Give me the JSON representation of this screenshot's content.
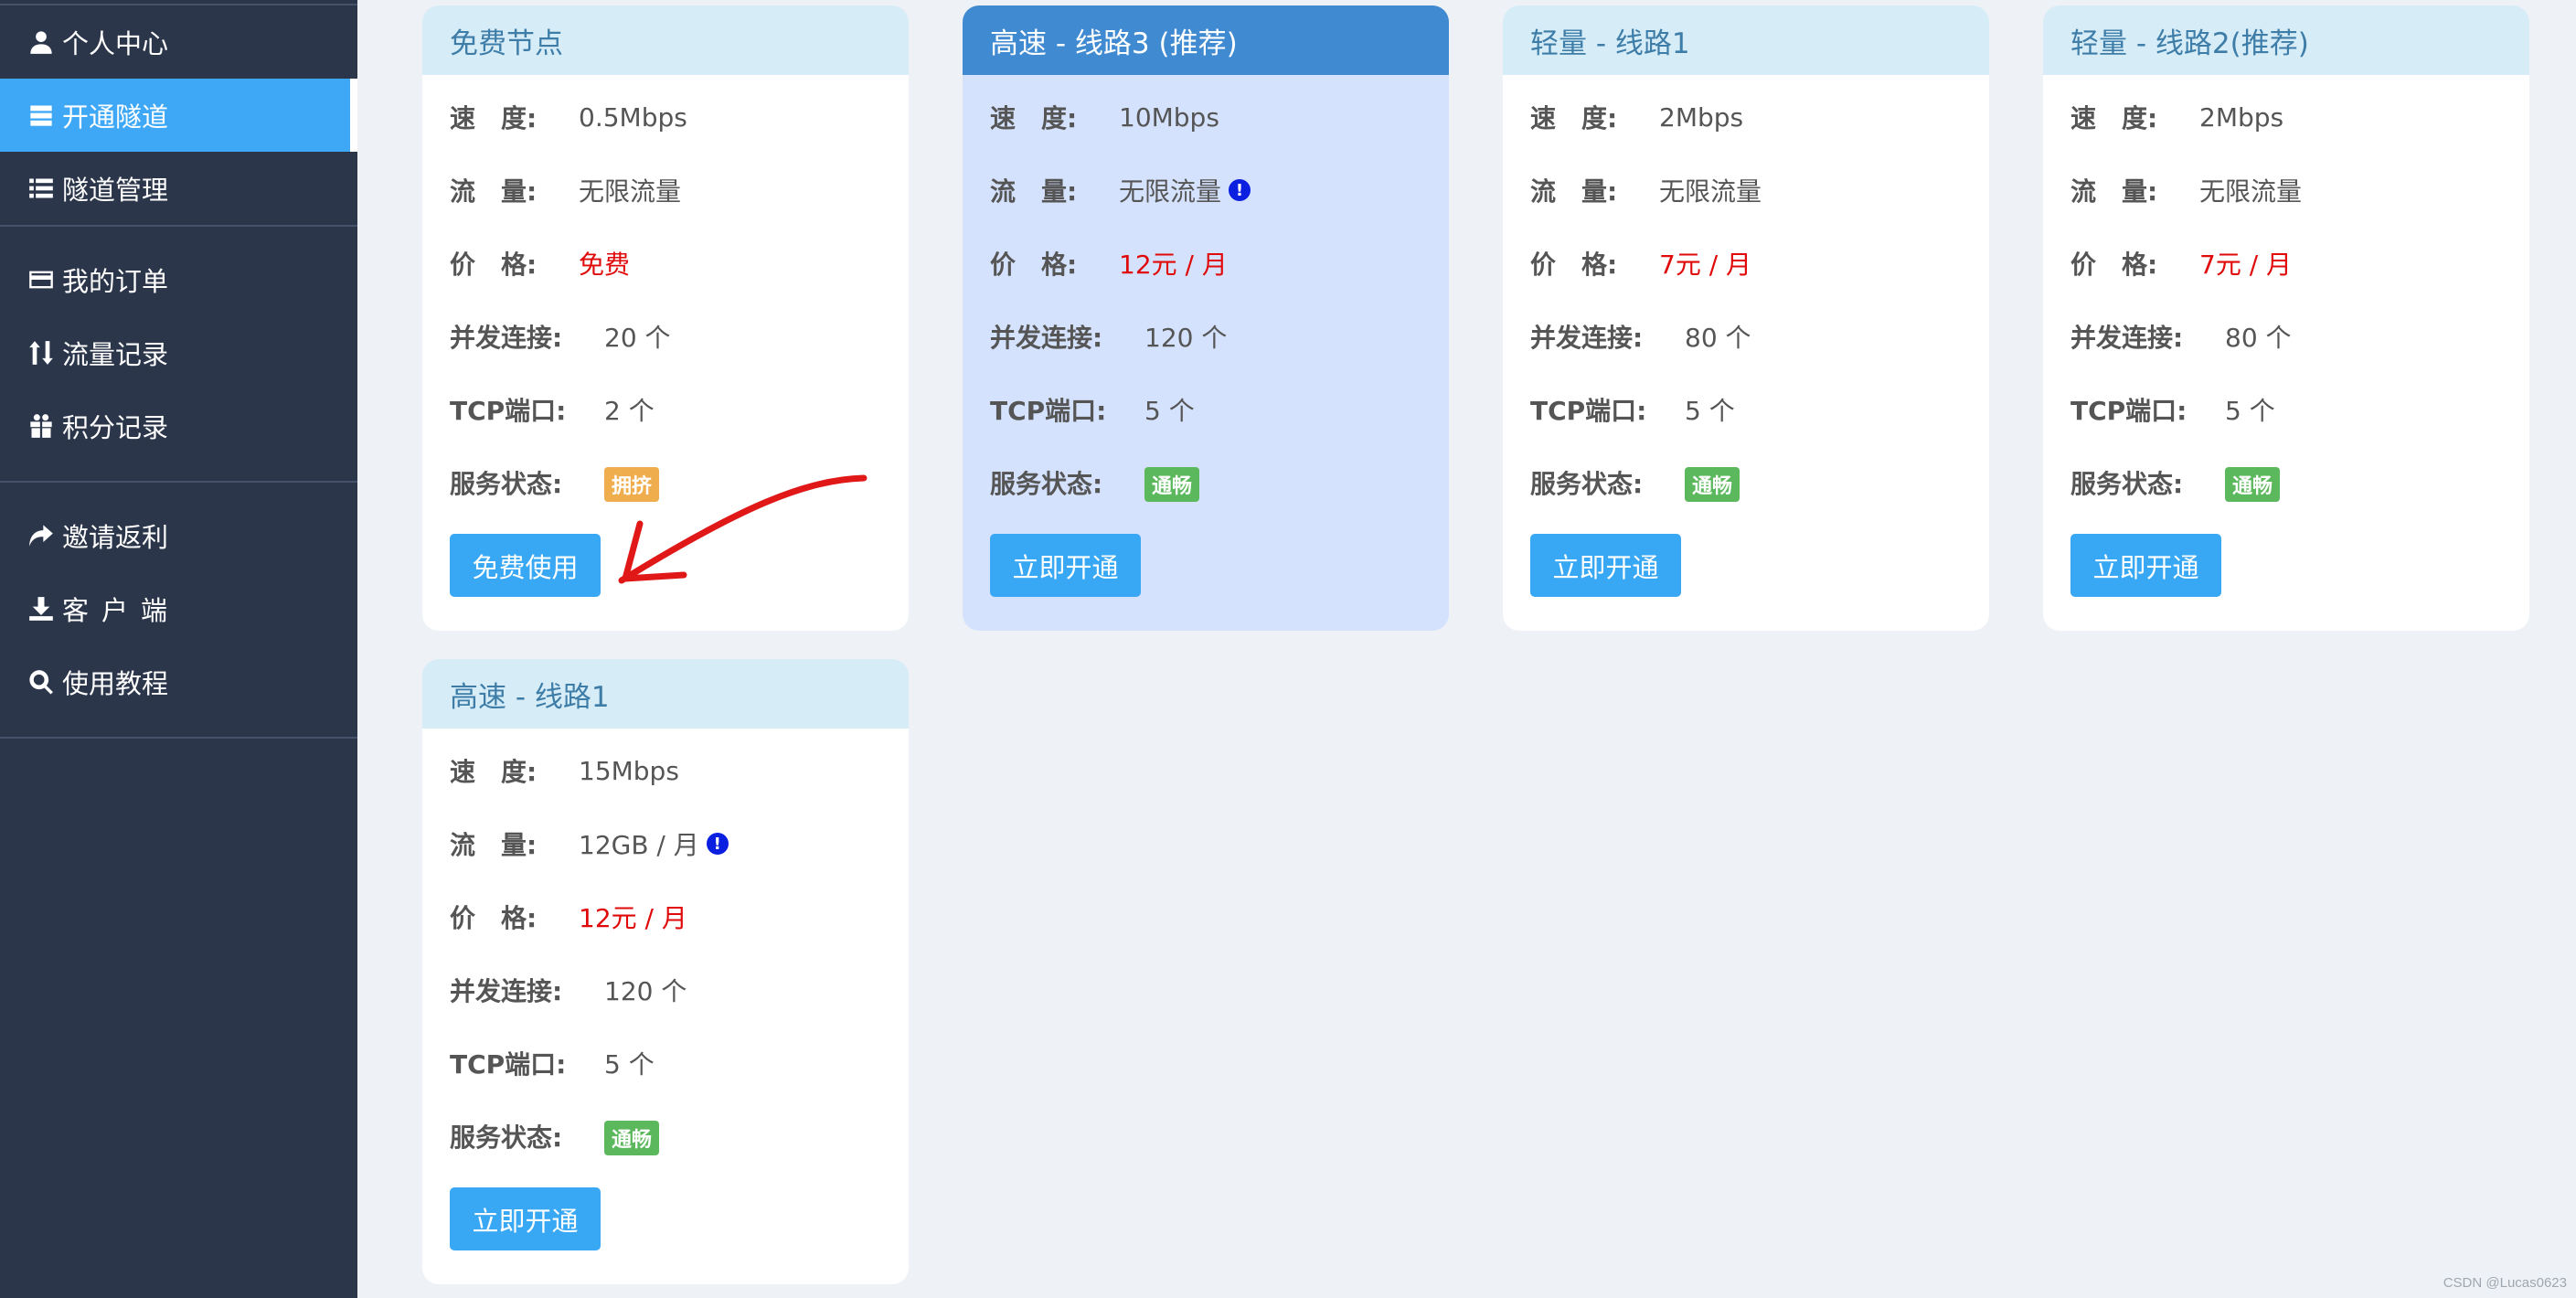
{
  "sidebar": {
    "groups": [
      {
        "items": [
          {
            "label": "个人中心",
            "icon": "user-icon"
          },
          {
            "label": "开通隧道",
            "icon": "server-icon",
            "active": true
          },
          {
            "label": "隧道管理",
            "icon": "list-icon"
          }
        ]
      },
      {
        "items": [
          {
            "label": "我的订单",
            "icon": "credit-card-icon"
          },
          {
            "label": "流量记录",
            "icon": "sort-arrows-icon"
          },
          {
            "label": "积分记录",
            "icon": "gift-icon"
          }
        ]
      },
      {
        "items": [
          {
            "label": "邀请返利",
            "icon": "share-arrow-icon"
          },
          {
            "label": "客户端",
            "icon": "download-icon"
          },
          {
            "label": "使用教程",
            "icon": "search-icon"
          }
        ]
      }
    ]
  },
  "labels": {
    "speed": "速　度:",
    "traffic": "流　量:",
    "price": "价　格:",
    "concurrent": "并发连接:",
    "tcp_ports": "TCP端口:",
    "status": "服务状态:"
  },
  "cards": [
    {
      "title": "免费节点",
      "speed": "0.5Mbps",
      "traffic": "无限流量",
      "price": "免费",
      "concurrent": "20 个",
      "tcp_ports": "2 个",
      "status": "拥挤",
      "status_color": "#f0ad4e",
      "button": "免费使用"
    },
    {
      "title": "高速 - 线路3 (推荐)",
      "speed": "10Mbps",
      "traffic": "无限流量",
      "traffic_info": "!",
      "price": "12元 / 月",
      "concurrent": "120 个",
      "tcp_ports": "5 个",
      "status": "通畅",
      "status_color": "#5cb85c",
      "button": "立即开通"
    },
    {
      "title": "轻量 - 线路1",
      "speed": "2Mbps",
      "traffic": "无限流量",
      "price": "7元 / 月",
      "concurrent": "80 个",
      "tcp_ports": "5 个",
      "status": "通畅",
      "status_color": "#5cb85c",
      "button": "立即开通"
    },
    {
      "title": "轻量 - 线路2(推荐)",
      "speed": "2Mbps",
      "traffic": "无限流量",
      "price": "7元 / 月",
      "concurrent": "80 个",
      "tcp_ports": "5 个",
      "status": "通畅",
      "status_color": "#5cb85c",
      "button": "立即开通"
    },
    {
      "title": "高速 - 线路1",
      "speed": "15Mbps",
      "traffic": "12GB / 月",
      "traffic_info": "!",
      "price": "12元 / 月",
      "concurrent": "120 个",
      "tcp_ports": "5 个",
      "status": "通畅",
      "status_color": "#5cb85c",
      "button": "立即开通"
    }
  ],
  "colors": {
    "sidebar_bg": "#2b364a",
    "active_item": "#3ea8f6",
    "button": "#39a8f4",
    "price_red": "#e00a0a",
    "annotation_arrow": "#e01818"
  },
  "watermark": "CSDN @Lucas0623"
}
